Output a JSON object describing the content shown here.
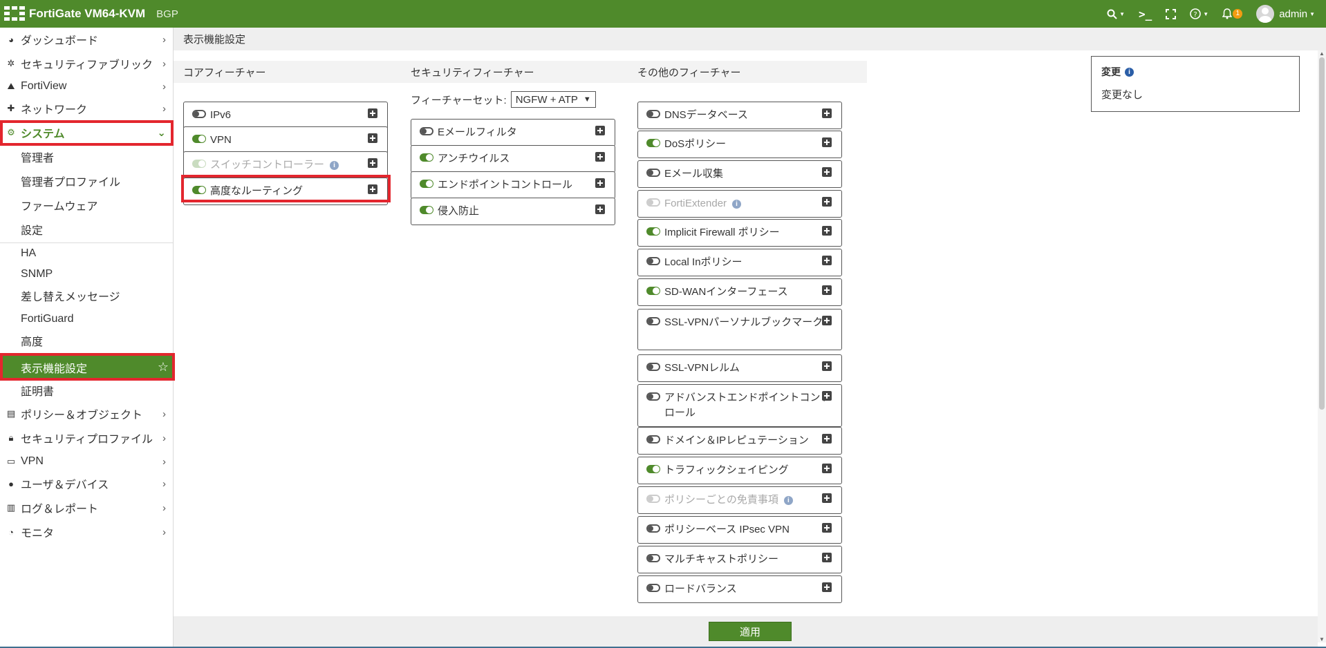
{
  "topbar": {
    "product": "FortiGate VM64-KVM",
    "vdom": "BGP",
    "notification_count": "1",
    "user": "admin"
  },
  "sidebar": {
    "items": [
      {
        "label": "ダッシュボード",
        "icon": "dashboard-icon"
      },
      {
        "label": "セキュリティファブリック",
        "icon": "fabric-icon"
      },
      {
        "label": "FortiView",
        "icon": "chart-icon"
      },
      {
        "label": "ネットワーク",
        "icon": "network-icon"
      },
      {
        "label": "システム",
        "icon": "gear-icon"
      }
    ],
    "system_sub": [
      "管理者",
      "管理者プロファイル",
      "ファームウェア",
      "設定",
      "HA",
      "SNMP",
      "差し替えメッセージ",
      "FortiGuard",
      "高度",
      "表示機能設定",
      "証明書"
    ],
    "lower_items": [
      {
        "label": "ポリシー＆オブジェクト",
        "icon": "policy-icon"
      },
      {
        "label": "セキュリティプロファイル",
        "icon": "lock-icon"
      },
      {
        "label": "VPN",
        "icon": "laptop-icon"
      },
      {
        "label": "ユーザ＆デバイス",
        "icon": "user-icon"
      },
      {
        "label": "ログ＆レポート",
        "icon": "bar-chart-icon"
      },
      {
        "label": "モニタ",
        "icon": "pie-icon"
      }
    ]
  },
  "breadcrumb": "表示機能設定",
  "columns": {
    "core": {
      "title": "コアフィーチャー",
      "features": [
        {
          "label": "IPv6",
          "state": "off"
        },
        {
          "label": "VPN",
          "state": "on"
        },
        {
          "label": "スイッチコントローラー",
          "state": "disabled-on",
          "info": true
        },
        {
          "label": "高度なルーティング",
          "state": "on"
        }
      ]
    },
    "security": {
      "title": "セキュリティフィーチャー",
      "featureset_label": "フィーチャーセット:",
      "featureset_value": "NGFW + ATP",
      "features": [
        {
          "label": "Eメールフィルタ",
          "state": "off"
        },
        {
          "label": "アンチウイルス",
          "state": "on"
        },
        {
          "label": "エンドポイントコントロール",
          "state": "on"
        },
        {
          "label": "侵入防止",
          "state": "on"
        }
      ]
    },
    "other": {
      "title": "その他のフィーチャー",
      "features": [
        {
          "label": "DNSデータベース",
          "state": "off"
        },
        {
          "label": "DoSポリシー",
          "state": "on"
        },
        {
          "label": "Eメール収集",
          "state": "off"
        },
        {
          "label": "FortiExtender",
          "state": "disabled-off",
          "info": true
        },
        {
          "label": "Implicit Firewall ポリシー",
          "state": "on"
        },
        {
          "label": "Local Inポリシー",
          "state": "off"
        },
        {
          "label": "SD-WANインターフェース",
          "state": "on"
        },
        {
          "label": "SSL-VPNパーソナルブックマーク",
          "state": "off"
        },
        {
          "label": "SSL-VPNレルム",
          "state": "off"
        },
        {
          "label": "アドバンストエンドポイントコントロール",
          "state": "off"
        },
        {
          "label": "ドメイン＆IPレピュテーション",
          "state": "off"
        },
        {
          "label": "トラフィックシェイピング",
          "state": "on"
        },
        {
          "label": "ポリシーごとの免責事項",
          "state": "disabled-off",
          "info": true
        },
        {
          "label": "ポリシーベース IPsec VPN",
          "state": "off"
        },
        {
          "label": "マルチキャストポリシー",
          "state": "off"
        },
        {
          "label": "ロードバランス",
          "state": "off"
        }
      ]
    }
  },
  "changes": {
    "title": "変更",
    "value": "変更なし"
  },
  "apply_label": "適用",
  "colors": {
    "brand": "#4f8a2b",
    "highlight": "#e3262e"
  }
}
